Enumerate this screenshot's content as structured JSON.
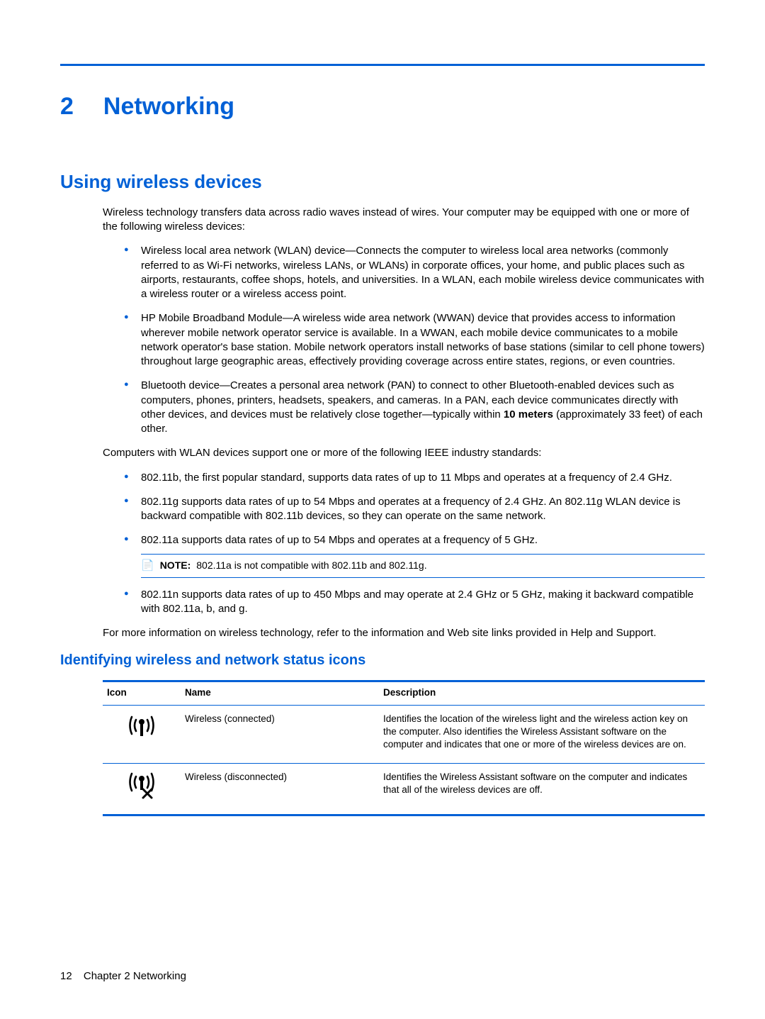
{
  "chapter": {
    "number": "2",
    "title": "Networking"
  },
  "h2": "Using wireless devices",
  "intro": "Wireless technology transfers data across radio waves instead of wires. Your computer may be equipped with one or more of the following wireless devices:",
  "devices": [
    "Wireless local area network (WLAN) device—Connects the computer to wireless local area networks (commonly referred to as Wi-Fi networks, wireless LANs, or WLANs) in corporate offices, your home, and public places such as airports, restaurants, coffee shops, hotels, and universities. In a WLAN, each mobile wireless device communicates with a wireless router or a wireless access point.",
    "HP Mobile Broadband Module—A wireless wide area network (WWAN) device that provides access to information wherever mobile network operator service is available. In a WWAN, each mobile device communicates to a mobile network operator's base station. Mobile network operators install networks of base stations (similar to cell phone towers) throughout large geographic areas, effectively providing coverage across entire states, regions, or even countries."
  ],
  "bt_prefix": "Bluetooth device—Creates a personal area network (PAN) to connect to other Bluetooth-enabled devices such as computers, phones, printers, headsets, speakers, and cameras. In a PAN, each device communicates directly with other devices, and devices must be relatively close together—typically within ",
  "bt_bold": "10 meters",
  "bt_suffix": " (approximately 33 feet) of each other.",
  "ieee_intro": "Computers with WLAN devices support one or more of the following IEEE industry standards:",
  "ieee": [
    "802.11b, the first popular standard, supports data rates of up to 11 Mbps and operates at a frequency of 2.4 GHz.",
    "802.11g supports data rates of up to 54 Mbps and operates at a frequency of 2.4 GHz. An 802.11g WLAN device is backward compatible with 802.11b devices, so they can operate on the same network.",
    "802.11a supports data rates of up to 54 Mbps and operates at a frequency of 5 GHz."
  ],
  "note_label": "NOTE:",
  "note_text": "802.11a is not compatible with 802.11b and 802.11g.",
  "ieee_last": "802.11n supports data rates of up to 450 Mbps and may operate at 2.4 GHz or 5 GHz, making it backward compatible with 802.11a, b, and g.",
  "more_info": "For more information on wireless technology, refer to the information and Web site links provided in Help and Support.",
  "h3": "Identifying wireless and network status icons",
  "table": {
    "headers": {
      "icon": "Icon",
      "name": "Name",
      "desc": "Description"
    },
    "rows": [
      {
        "name": "Wireless (connected)",
        "desc": "Identifies the location of the wireless light and the wireless action key on the computer. Also identifies the Wireless Assistant software on the computer and indicates that one or more of the wireless devices are on."
      },
      {
        "name": "Wireless (disconnected)",
        "desc": "Identifies the Wireless Assistant software on the computer and indicates that all of the wireless devices are off."
      }
    ]
  },
  "footer": {
    "page": "12",
    "chap": "Chapter 2   Networking"
  }
}
